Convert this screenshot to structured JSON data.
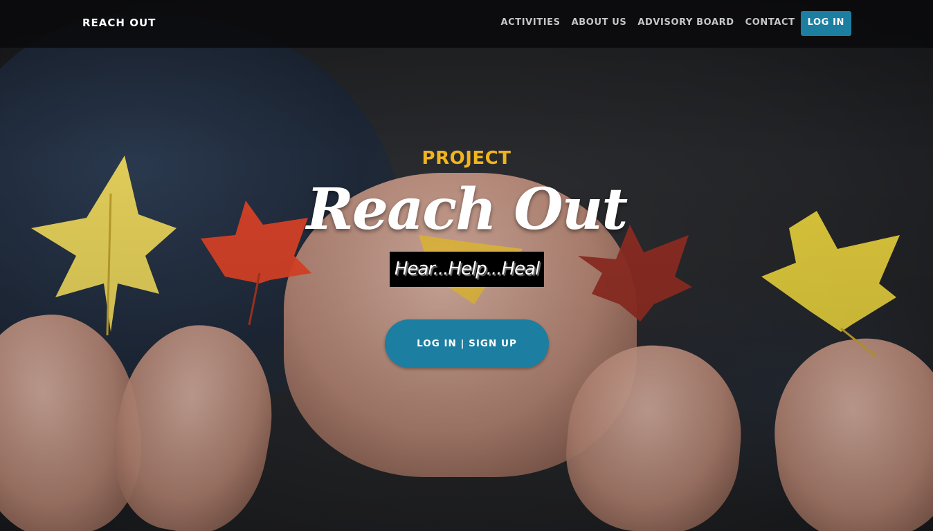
{
  "navbar": {
    "brand": "REACH OUT",
    "links": [
      {
        "label": "ACTIVITIES"
      },
      {
        "label": "ABOUT US"
      },
      {
        "label": "ADVISORY BOARD"
      },
      {
        "label": "CONTACT"
      }
    ],
    "login_label": "LOG IN"
  },
  "hero": {
    "eyebrow": "PROJECT",
    "title": "Reach Out",
    "tagline": "Hear...Help...Heal",
    "cta_label": "LOG IN | SIGN UP",
    "background_image": "hands holding autumn maple leaves"
  },
  "colors": {
    "accent": "#1c7ea1",
    "eyebrow": "#f0b41f",
    "navbar_bg": "#0a0a0c",
    "title": "#ffffff"
  }
}
